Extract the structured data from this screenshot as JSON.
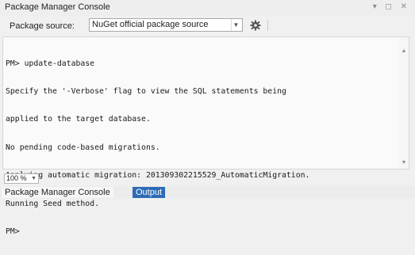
{
  "window": {
    "title": "Package Manager Console",
    "controls": "▾ ◻ ✕"
  },
  "toolbar": {
    "package_source_label": "Package source:",
    "package_source_value": "NuGet official package source",
    "settings_icon": "gear-icon"
  },
  "console": {
    "lines": [
      "PM> update-database",
      "Specify the '-Verbose' flag to view the SQL statements being",
      "applied to the target database.",
      "No pending code-based migrations.",
      "Applying automatic migration: 201309302215529_AutomaticMigration.",
      "Running Seed method.",
      "PM>"
    ]
  },
  "zoom": {
    "value": "100 %"
  },
  "tabs": [
    {
      "label": "Package Manager Console",
      "active": true
    },
    {
      "label": "Output",
      "active": false
    }
  ],
  "colors": {
    "tab_inactive_bg": "#2d6bb5",
    "console_bg": "#fafafa"
  }
}
